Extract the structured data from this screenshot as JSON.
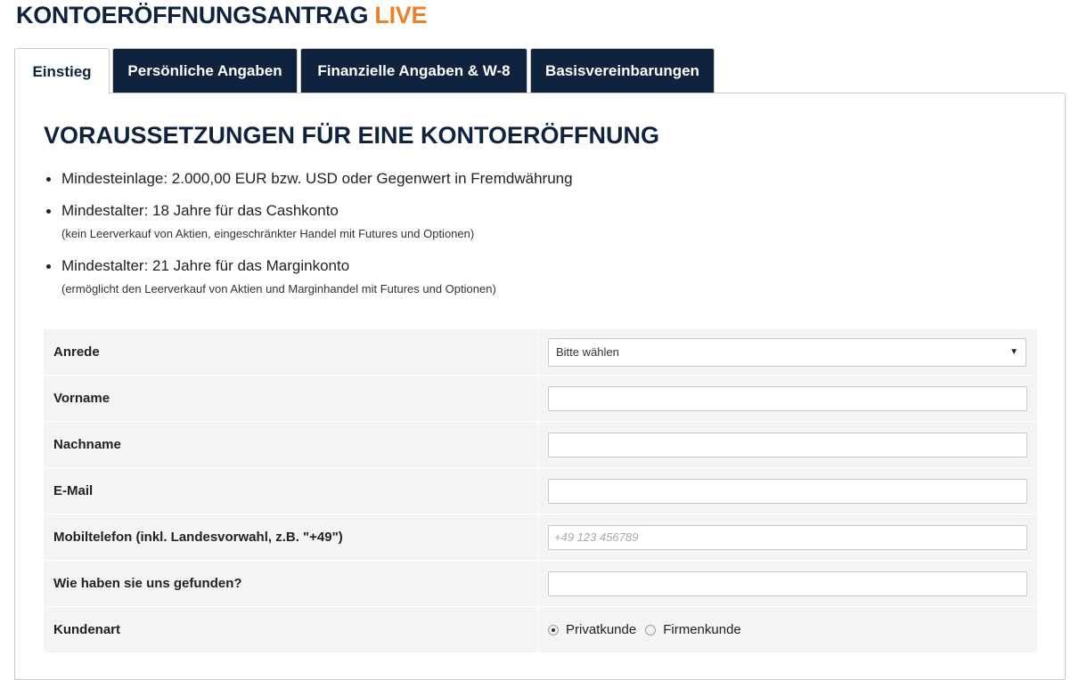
{
  "header": {
    "title": "KONTOERÖFFNUNGSANTRAG",
    "title_suffix": "LIVE"
  },
  "colors": {
    "navy": "#0f233e",
    "accent": "#e8832a"
  },
  "tabs": [
    {
      "label": "Einstieg",
      "active": true
    },
    {
      "label": "Persönliche Angaben",
      "active": false
    },
    {
      "label": "Finanzielle Angaben & W-8",
      "active": false
    },
    {
      "label": "Basisvereinbarungen",
      "active": false
    }
  ],
  "requirements": {
    "title": "VORAUSSETZUNGEN FÜR EINE KONTOERÖFFNUNG",
    "items": [
      {
        "text": "Mindesteinlage: 2.000,00 EUR bzw. USD oder Gegenwert in Fremdwährung",
        "note": ""
      },
      {
        "text": "Mindestalter: 18 Jahre für das Cashkonto",
        "note": "(kein Leerverkauf von Aktien, eingeschränkter Handel mit Futures und Optionen)"
      },
      {
        "text": "Mindestalter: 21 Jahre für das Marginkonto",
        "note": "(ermöglicht den Leerverkauf von Aktien und Marginhandel mit Futures und Optionen)"
      }
    ]
  },
  "form": {
    "salutation": {
      "label": "Anrede",
      "selected": "Bitte wählen",
      "icon": "chevron-down-icon"
    },
    "first_name": {
      "label": "Vorname",
      "value": "",
      "placeholder": ""
    },
    "last_name": {
      "label": "Nachname",
      "value": "",
      "placeholder": ""
    },
    "email": {
      "label": "E-Mail",
      "value": "",
      "placeholder": ""
    },
    "mobile": {
      "label": "Mobiltelefon (inkl. Landesvorwahl, z.B. \"+49\")",
      "value": "",
      "placeholder": "+49 123 456789"
    },
    "referral": {
      "label": "Wie haben sie uns gefunden?",
      "value": "",
      "placeholder": ""
    },
    "customer_type": {
      "label": "Kundenart",
      "options": [
        {
          "label": "Privatkunde",
          "checked": true
        },
        {
          "label": "Firmenkunde",
          "checked": false
        }
      ]
    }
  }
}
